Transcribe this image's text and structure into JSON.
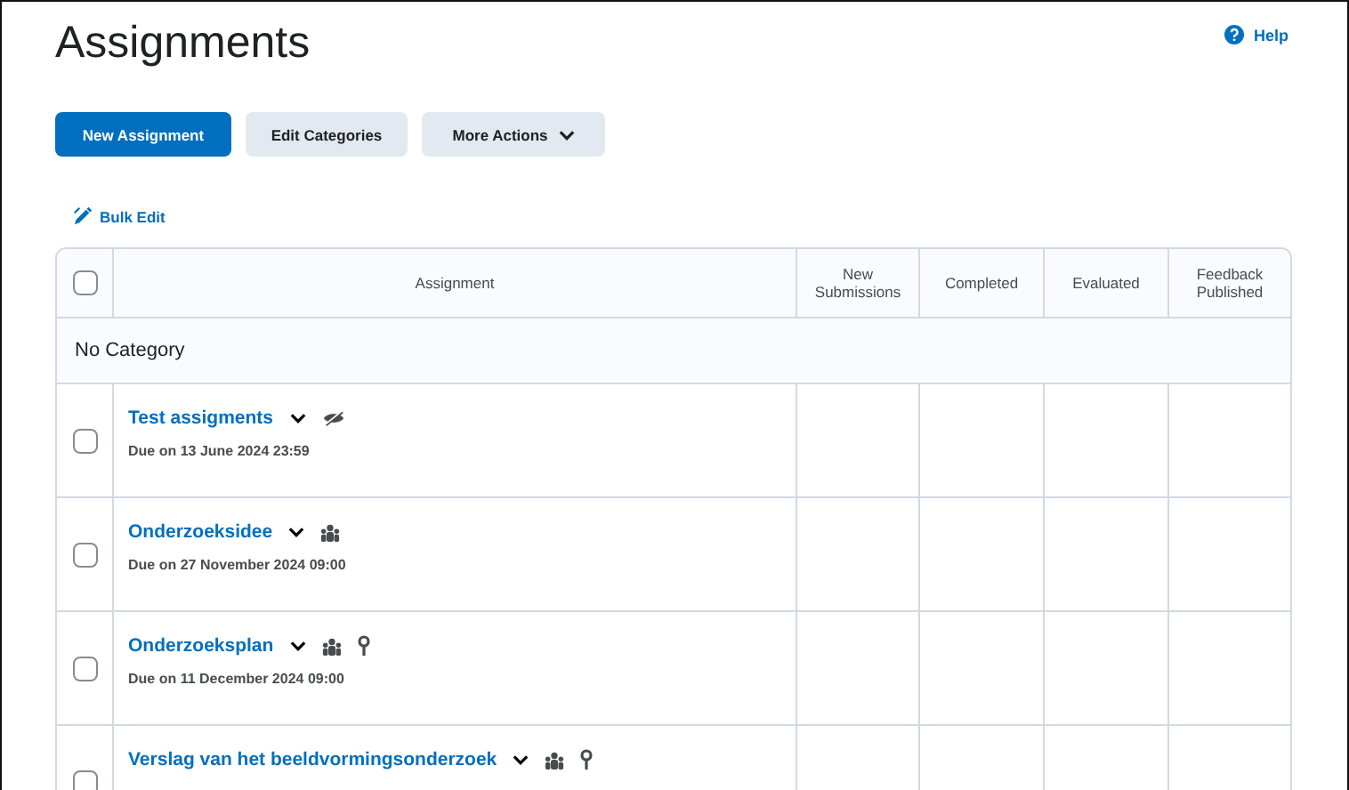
{
  "title": "Assignments",
  "help": "Help",
  "buttons": [
    {
      "label": "New Assignment",
      "kind": "primary"
    },
    {
      "label": "Edit Categories",
      "kind": "secondary"
    },
    {
      "label": "More Actions",
      "kind": "menu"
    }
  ],
  "bulk_edit": "Bulk Edit",
  "table": {
    "select_all": {
      "checked": false
    },
    "columns": [
      "Assignment",
      "New Submissions",
      "Completed",
      "Evaluated",
      "Feedback Published"
    ],
    "category": "No Category",
    "rows": [
      {
        "name": "Test assigments",
        "due": "Due on 13 June 2024 23:59",
        "checked": false,
        "icons": [
          {
            "kind": "hidden"
          }
        ]
      },
      {
        "name": "Onderzoeksidee",
        "due": "Due on 27 November 2024 09:00",
        "checked": false,
        "icons": [
          {
            "kind": "group"
          }
        ]
      },
      {
        "name": "Onderzoeksplan",
        "due": "Due on 11 December 2024 09:00",
        "checked": false,
        "icons": [
          {
            "kind": "group"
          },
          {
            "kind": "restricted"
          }
        ]
      },
      {
        "name": "Verslag van het beeldvormingsonderzoek",
        "checked": false,
        "icons": [
          {
            "kind": "group"
          },
          {
            "kind": "restricted"
          }
        ]
      }
    ]
  }
}
